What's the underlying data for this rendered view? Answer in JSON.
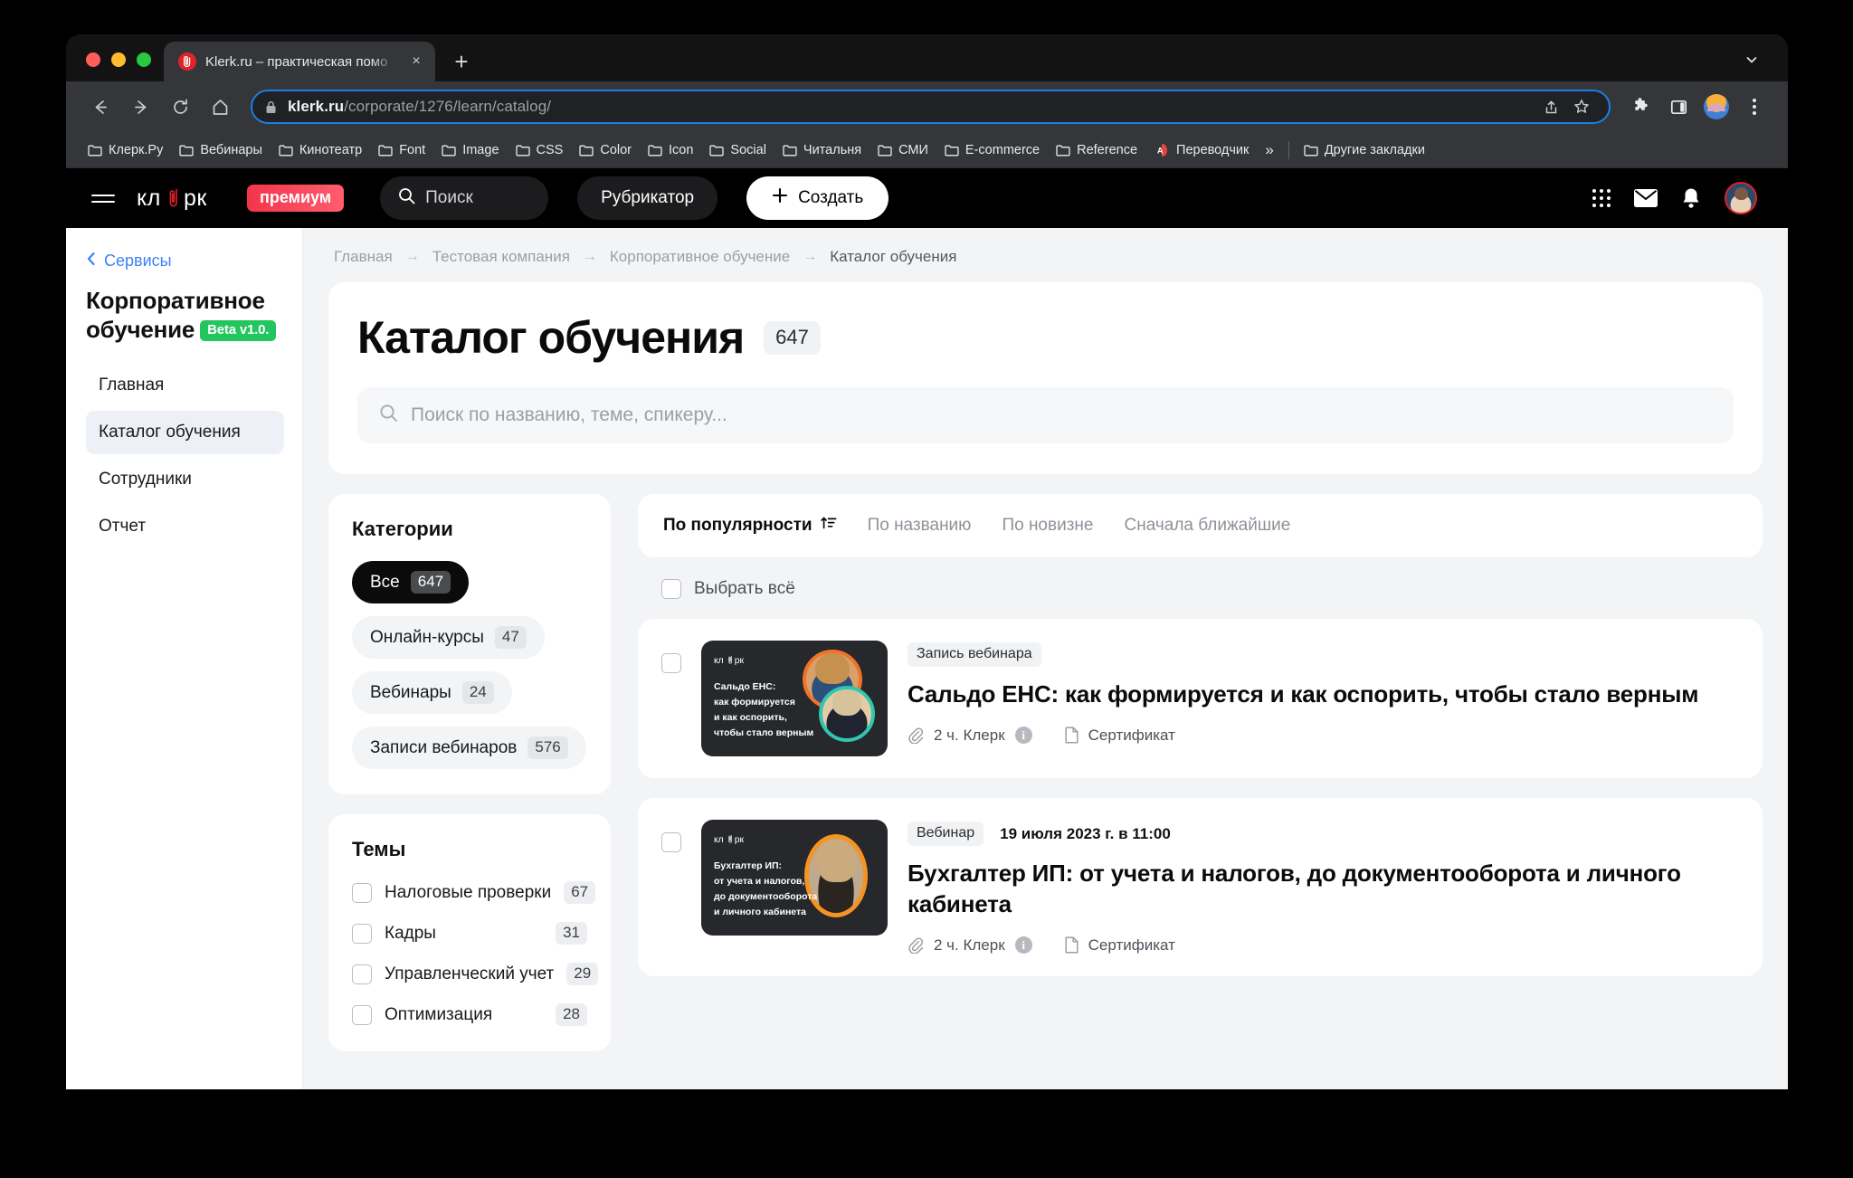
{
  "browser": {
    "tab": {
      "title": "Klerk.ru – практическая помо",
      "favicon": "klerk-clip-icon",
      "close": "×"
    },
    "newtab_label": "+",
    "tab_search_icon": "chevron-down-icon",
    "nav": {
      "back": "back-arrow-icon",
      "forward": "forward-arrow-icon",
      "reload": "reload-icon",
      "home": "home-icon"
    },
    "omnibox": {
      "lock": "lock-icon",
      "host": "klerk.ru",
      "path": "/corporate/1276/learn/catalog/",
      "share": "share-icon",
      "bookmark": "star-icon"
    },
    "toolbar_icons": {
      "extensions": "puzzle-icon",
      "side_panel": "side-panel-icon",
      "profile": "profile-avatar",
      "menu": "kebab-menu-icon"
    },
    "bookmarks": [
      {
        "label": "Клерк.Ру",
        "icon": "folder-icon"
      },
      {
        "label": "Вебинары",
        "icon": "folder-icon"
      },
      {
        "label": "Кинотеатр",
        "icon": "folder-icon"
      },
      {
        "label": "Font",
        "icon": "folder-icon"
      },
      {
        "label": "Image",
        "icon": "folder-icon"
      },
      {
        "label": "CSS",
        "icon": "folder-icon"
      },
      {
        "label": "Color",
        "icon": "folder-icon"
      },
      {
        "label": "Icon",
        "icon": "folder-icon"
      },
      {
        "label": "Social",
        "icon": "folder-icon"
      },
      {
        "label": "Читальня",
        "icon": "folder-icon"
      },
      {
        "label": "СМИ",
        "icon": "folder-icon"
      },
      {
        "label": "E-commerce",
        "icon": "folder-icon"
      },
      {
        "label": "Reference",
        "icon": "folder-icon"
      },
      {
        "label": "Переводчик",
        "icon": "translate-icon"
      }
    ],
    "bookmarks_overflow": "»",
    "other_bookmarks": {
      "label": "Другие закладки",
      "icon": "folder-icon"
    }
  },
  "site_header": {
    "menu_icon": "burger-menu-icon",
    "logo": "клерк",
    "logo_badge": "премиум",
    "search_placeholder": "Поиск",
    "rubricator_label": "Рубрикатор",
    "create_label": "Создать",
    "icons": {
      "apps": "apps-grid-icon",
      "mail": "mail-icon",
      "bell": "bell-icon",
      "avatar": "user-avatar"
    }
  },
  "sidebar": {
    "back_label": "Сервисы",
    "title": "Корпоративное обучение",
    "beta_badge": "Beta v1.0.",
    "items": [
      {
        "label": "Главная",
        "active": false
      },
      {
        "label": "Каталог обучения",
        "active": true
      },
      {
        "label": "Сотрудники",
        "active": false
      },
      {
        "label": "Отчет",
        "active": false
      }
    ]
  },
  "breadcrumbs": [
    "Главная",
    "Тестовая компания",
    "Корпоративное обучение",
    "Каталог обучения"
  ],
  "breadcrumb_arrow": "→",
  "hero": {
    "title": "Каталог обучения",
    "count": "647",
    "search_placeholder": "Поиск по названию, теме, спикеру...",
    "search_icon": "search-icon"
  },
  "categories": {
    "title": "Категории",
    "items": [
      {
        "label": "Все",
        "count": "647",
        "active": true
      },
      {
        "label": "Онлайн-курсы",
        "count": "47",
        "active": false
      },
      {
        "label": "Вебинары",
        "count": "24",
        "active": false
      },
      {
        "label": "Записи вебинаров",
        "count": "576",
        "active": false
      }
    ]
  },
  "topics": {
    "title": "Темы",
    "items": [
      {
        "label": "Налоговые проверки",
        "count": "67",
        "checked": false
      },
      {
        "label": "Кадры",
        "count": "31",
        "checked": false
      },
      {
        "label": "Управленческий учет",
        "count": "29",
        "checked": false
      },
      {
        "label": "Оптимизация",
        "count": "28",
        "checked": false
      }
    ]
  },
  "sort": {
    "items": [
      {
        "label": "По популярности",
        "active": true,
        "icon": "sort-asc-icon"
      },
      {
        "label": "По названию",
        "active": false
      },
      {
        "label": "По новизне",
        "active": false
      },
      {
        "label": "Сначала ближайшие",
        "active": false
      }
    ]
  },
  "select_all": {
    "label": "Выбрать всё",
    "checked": false
  },
  "courses": [
    {
      "pill": "Запись вебинара",
      "date": "",
      "title": "Сальдо ЕНС: как формируется и как оспорить, чтобы стало верным",
      "duration": "2 ч. Клерк",
      "certificate": "Сертификат",
      "thumb_logo": "клерк",
      "thumb_lines": [
        "Сальдо ЕНС:",
        "как формируется",
        "и как оспорить,",
        "чтобы стало верным"
      ],
      "faces": 2,
      "checked": false
    },
    {
      "pill": "Вебинар",
      "date": "19 июля 2023 г. в 11:00",
      "title": "Бухгалтер ИП: от учета и налогов, до документооборота и личного кабинета",
      "duration": "2 ч. Клерк",
      "certificate": "Сертификат",
      "thumb_logo": "клерк",
      "thumb_lines": [
        "Бухгалтер ИП:",
        "от учета и налогов,",
        "до документооборота",
        "и личного кабинета"
      ],
      "faces": 1,
      "checked": false
    }
  ],
  "colors": {
    "accent_red": "#e02229",
    "premium_gradient_start": "#f4344b",
    "beta_green": "#22c55e",
    "link_blue": "#3b82f6",
    "page_bg": "#f3f4f6",
    "card_bg": "#ffffff",
    "dark": "#0b0b0c",
    "omnibox_focus": "#1f7ce8"
  }
}
